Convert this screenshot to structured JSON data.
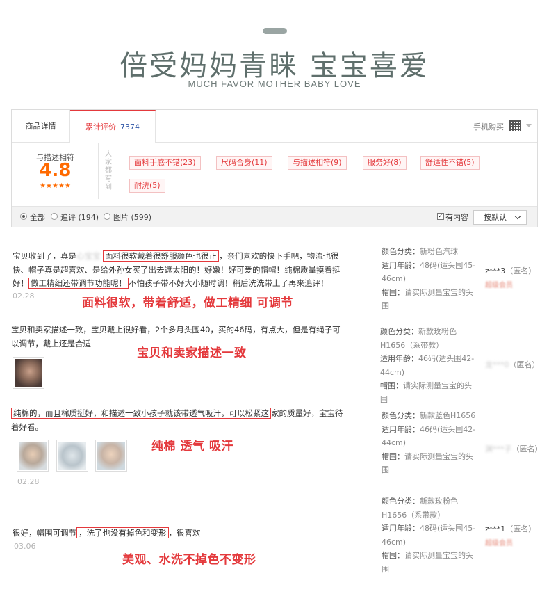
{
  "hero": {
    "title": "倍受妈妈青睐 宝宝喜爱",
    "subtitle": "MUCH FAVOR MOTHER BABY LOVE"
  },
  "tabs": {
    "detail": "商品详情",
    "reviews_label": "累计评价",
    "reviews_count": "7374",
    "mobile_buy": "手机购买"
  },
  "rating": {
    "label": "与描述相符",
    "score": "4.8",
    "stars": "★★★★★",
    "tags_head": "大家都写到",
    "tags": [
      "面料手感不错(23)",
      "尺码合身(11)",
      "与描述相符(9)",
      "服务好(8)",
      "舒适性不错(5)",
      "耐洗(5)"
    ]
  },
  "filters": {
    "all": "全部",
    "followup": "追评 (194)",
    "images": "图片 (599)",
    "has_content": "有内容",
    "sort": "按默认"
  },
  "reviews": [
    {
      "line1_a": "宝贝收到了，真是",
      "line1_blur": "心宝宝",
      "line1_hl": "面料很软戴着很舒服颜色也很正",
      "line1_b": "，亲们喜欢的快下手吧，物流也很",
      "line2": "快、帽子真是超喜欢、是给外孙女买了出去遮太阳的！好嫩！好可爱的帽帽！纯棉质量摸着挺",
      "line3_a": "好！",
      "line3_hl": "做工精细还带调节功能呢！",
      "line3_b": "不怕孩子带不好大小随时调！稍后洗洗带上了再来追评！",
      "date": "02.28",
      "callout": "面料很软，带着舒适，做工精细 可调节",
      "meta_color_k": "颜色分类：",
      "meta_color_v": "新粉色汽球",
      "meta_age_k": "适用年龄：",
      "meta_age_v": "48码(适头围45-46cm)",
      "meta_head_k": "帽围：",
      "meta_head_v": "请实际测量宝宝的头围",
      "user": "z***3",
      "anon": "（匿名）",
      "vip": "超级会员"
    },
    {
      "line1": "宝贝和卖家描述一致，宝贝戴上很好看，2个多月头围40，买的46码，有点大，但是有绳子可",
      "line2": "以调节，戴上还是合适",
      "callout": "宝贝和卖家描述一致",
      "meta_color_k": "颜色分类：",
      "meta_color_v": "新款玫粉色H1656（系带款）",
      "meta_age_k": "适用年龄：",
      "meta_age_v": "46码(适头围42-44cm)",
      "meta_head_k": "帽围：",
      "meta_head_v": "请实际测量宝宝的头围",
      "user": "龙***0",
      "anon": "（匿名）"
    },
    {
      "line1_hl": "纯棉的，而且棉质挺好，和描述一致小孩子就该带透气吸汗，可以松紧这",
      "line1_b": "家的质量好，宝宝待",
      "line2": "着好看。",
      "date": "02.28",
      "callout": "纯棉 透气 吸汗",
      "meta_color_k": "颜色分类：",
      "meta_color_v": "新款蓝色H1656",
      "meta_age_k": "适用年龄：",
      "meta_age_v": "46码(适头围42-44cm)",
      "meta_head_k": "帽围：",
      "meta_head_v": "请实际测量宝宝的头围",
      "user": "渊***子",
      "anon": "（匿名）"
    },
    {
      "line1_a": "很好，帽围可调节",
      "line1_hl": "，洗了也没有掉色和变形",
      "line1_b": "，很喜欢",
      "date": "03.06",
      "callout": "美观、水洗不掉色不变形",
      "meta_color_k": "颜色分类：",
      "meta_color_v": "新款玫粉色H1656（系带款）",
      "meta_age_k": "适用年龄：",
      "meta_age_v": "48码(适头围45-46cm)",
      "meta_head_k": "帽围：",
      "meta_head_v": "请实际测量宝宝的头围",
      "user": "z***1",
      "anon": "（匿名）",
      "vip": "超级会员"
    }
  ],
  "colors": {
    "accent": "#e4393c",
    "score": "#ff6a00",
    "hero": "#5f6f6c"
  }
}
